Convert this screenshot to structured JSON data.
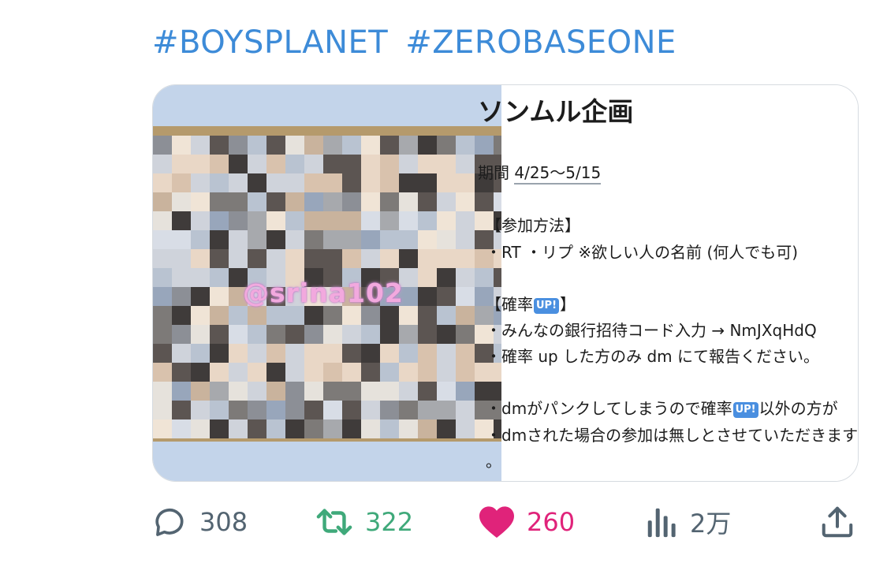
{
  "hashtags": [
    "#BOYSPLANET",
    "#ZEROBASEONE"
  ],
  "card": {
    "image_watermark": "@srina102",
    "doc": {
      "title": "ソンムル企画",
      "lines": [
        {
          "pre": "期間 ",
          "underlined": "4/25〜5/15"
        },
        {
          "text": "【参加方法】"
        },
        {
          "text": "・RT ・リプ ※欲しい人の名前 (何人でも可)"
        },
        {
          "pre": "【確率",
          "badge": "UP!",
          "post": "】"
        },
        {
          "text": "・みんなの銀行招待コード入力 → NmJXqHdQ"
        },
        {
          "text": "・確率 up した方のみ dm にて報告ください。"
        },
        {
          "pre": "・dmがパンクしてしまうので確率",
          "badge": "UP!",
          "post": "以外の方が"
        },
        {
          "text": "・dmされた場合の参加は無しとさせていただきます"
        },
        {
          "text": "。"
        }
      ]
    }
  },
  "actions": {
    "reply": {
      "icon": "reply-bubble-icon",
      "count": "308",
      "color": "#536471"
    },
    "retweet": {
      "icon": "retweet-icon",
      "count": "322",
      "color": "#3fa97a"
    },
    "like": {
      "icon": "heart-icon",
      "count": "260",
      "color": "#e0237a"
    },
    "views": {
      "icon": "bar-chart-icon",
      "count": "2万",
      "color": "#536471"
    },
    "share": {
      "icon": "share-upload-icon"
    }
  }
}
